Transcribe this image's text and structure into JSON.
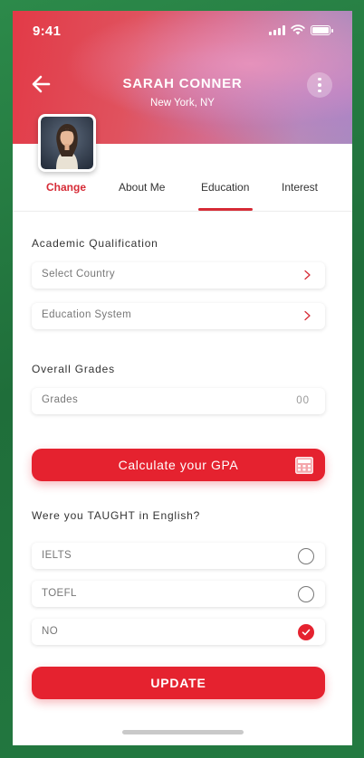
{
  "status_bar": {
    "time": "9:41"
  },
  "profile": {
    "name": "SARAH CONNER",
    "location": "New York, NY",
    "change_label": "Change"
  },
  "tabs": [
    {
      "label": "About Me",
      "active": false
    },
    {
      "label": "Education",
      "active": true
    },
    {
      "label": "Interest",
      "active": false
    }
  ],
  "academic": {
    "heading": "Academic Qualification",
    "country_placeholder": "Select Country",
    "system_placeholder": "Education System"
  },
  "grades": {
    "heading": "Overall Grades",
    "label": "Grades",
    "value": "00"
  },
  "gpa_button": {
    "label": "Calculate your GPA",
    "icon": "calculator-icon"
  },
  "english": {
    "question": "Were you TAUGHT in English?",
    "options": [
      {
        "label": "IELTS",
        "selected": false
      },
      {
        "label": "TOEFL",
        "selected": false
      },
      {
        "label": "NO",
        "selected": true
      }
    ]
  },
  "update_button": {
    "label": "UPDATE"
  },
  "colors": {
    "accent": "#e5222f",
    "text": "#333333",
    "muted": "#777777"
  }
}
